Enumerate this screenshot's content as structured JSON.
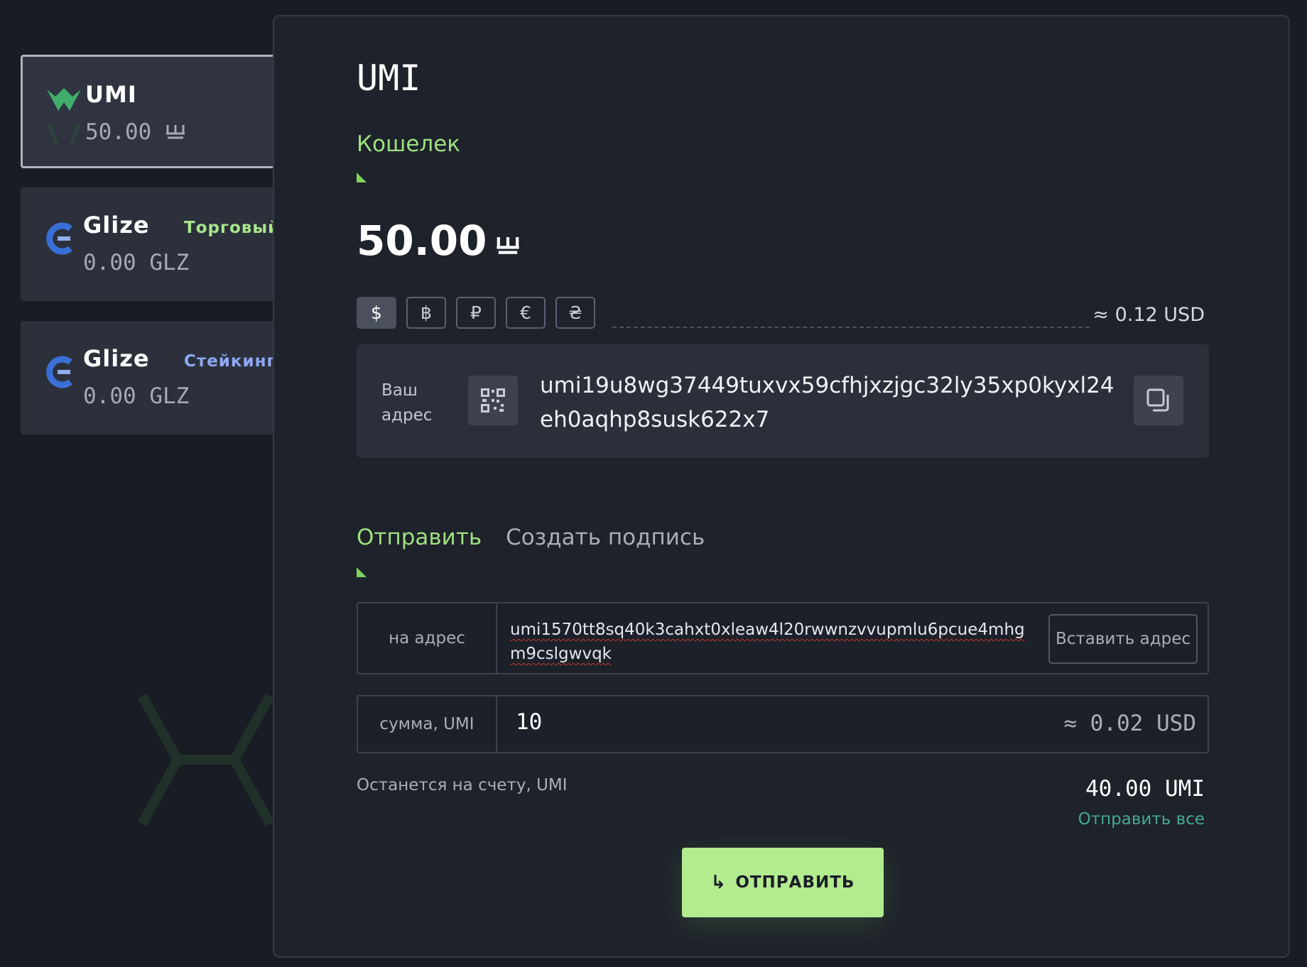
{
  "wallets": [
    {
      "name": "UMI",
      "tag": "",
      "balance": "50.00",
      "unit_icon": "umi-currency-icon"
    },
    {
      "name": "Glize",
      "tag": "Торговый",
      "balance": "0.00 GLZ"
    },
    {
      "name": "Glize",
      "tag": "Стейкинг",
      "balance": "0.00 GLZ"
    }
  ],
  "main": {
    "title": "UMI",
    "wallet_label": "Кошелек",
    "balance": "50.00",
    "currencies": [
      "$",
      "฿",
      "₽",
      "€",
      "₴"
    ],
    "selected_currency": "$",
    "approx_usd": "≈ 0.12 USD",
    "address_label": "Ваш адрес",
    "address": "umi19u8wg37449tuxvx59cfhjxzjgc32ly35xp0kyxl24eh0aqhp8susk622x7",
    "tabs": [
      {
        "label": "Отправить",
        "active": true
      },
      {
        "label": "Создать подпись",
        "active": false
      }
    ],
    "to_label": "на адрес",
    "to_value": "umi1570tt8sq40k3cahxt0xleaw4l20rwwnzvvupmlu6pcue4mhgm9cslgwvqk",
    "paste_label": "Вставить адрес",
    "amount_label": "сумма, UMI",
    "amount_value": "10",
    "amount_usd": "≈ 0.02 USD",
    "remain_label": "Останется на счету, UMI",
    "remain_value": "40.00 UMI",
    "send_all": "Отправить все",
    "send_button": "ОТПРАВИТЬ"
  },
  "colors": {
    "accent_green": "#9ee07f",
    "button_green": "#b3ec8f",
    "teal_link": "#45a88e",
    "tag_blue": "#8ea8f2"
  }
}
